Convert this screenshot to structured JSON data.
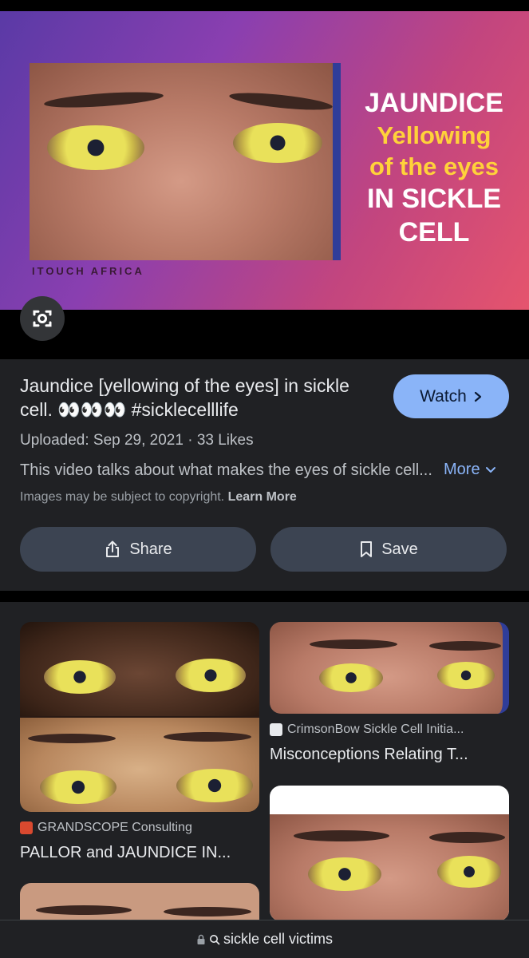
{
  "hero": {
    "credit": "ITOUCH AFRICA",
    "headline": [
      "JAUNDICE",
      "Yellowing",
      "of the eyes",
      "IN SICKLE",
      "CELL"
    ]
  },
  "icons": {
    "lens": "camera-lens-icon",
    "chevron_right": "chevron-right-icon",
    "chevron_down": "chevron-down-icon",
    "share": "share-icon",
    "bookmark": "bookmark-icon",
    "lock": "lock-icon",
    "search": "search-icon"
  },
  "info": {
    "title": "Jaundice [yellowing of the eyes] in sickle cell. 👀👀👀 #sicklecelllife",
    "watch_label": "Watch",
    "meta": "Uploaded: Sep 29, 2021 · 33 Likes",
    "description": "This video talks about what makes the eyes of sickle cell...",
    "more_label": "More",
    "copyright_text": "Images may be subject to copyright.",
    "learn_more": "Learn More",
    "share_label": "Share",
    "save_label": "Save"
  },
  "results": [
    {
      "source": "GRANDSCOPE Consulting",
      "title": "PALLOR and JAUNDICE IN...",
      "favicon_color": "#d9492f"
    },
    {
      "source": "CrimsonBow Sickle Cell Initia...",
      "title": "Misconceptions Relating T...",
      "favicon_color": "#e8eaed"
    }
  ],
  "bottom_bar": {
    "query": "sickle cell victims"
  },
  "colors": {
    "accent": "#8ab4f8",
    "panel": "#202124",
    "pill": "#3c4452"
  }
}
